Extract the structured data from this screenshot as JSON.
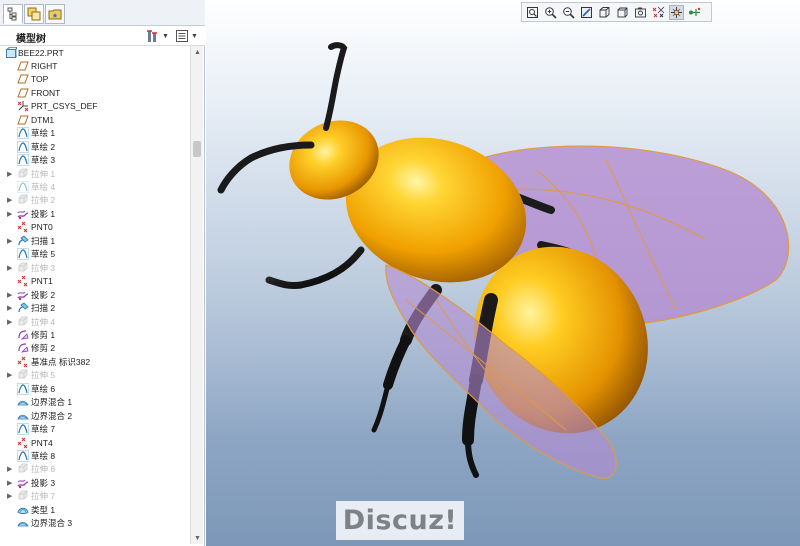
{
  "tabs": [
    {
      "icon": "model-tree-tab-icon",
      "active": true
    },
    {
      "icon": "layers-tab-icon",
      "active": false
    },
    {
      "icon": "favorites-folder-tab-icon",
      "active": false
    }
  ],
  "model_tree": {
    "title": "模型树",
    "items": [
      {
        "label": "BEE22.PRT",
        "icon": "part-icon",
        "expandable": false,
        "dim": false,
        "root": true
      },
      {
        "label": "RIGHT",
        "icon": "datum-plane-icon",
        "expandable": false,
        "dim": false
      },
      {
        "label": "TOP",
        "icon": "datum-plane-icon",
        "expandable": false,
        "dim": false
      },
      {
        "label": "FRONT",
        "icon": "datum-plane-icon",
        "expandable": false,
        "dim": false
      },
      {
        "label": "PRT_CSYS_DEF",
        "icon": "coordinate-system-icon",
        "expandable": false,
        "dim": false
      },
      {
        "label": "DTM1",
        "icon": "datum-plane-icon",
        "expandable": false,
        "dim": false
      },
      {
        "label": "草绘 1",
        "icon": "sketch-icon",
        "expandable": false,
        "dim": false
      },
      {
        "label": "草绘 2",
        "icon": "sketch-icon",
        "expandable": false,
        "dim": false
      },
      {
        "label": "草绘 3",
        "icon": "sketch-icon",
        "expandable": false,
        "dim": false
      },
      {
        "label": "拉伸 1",
        "icon": "extrude-icon",
        "expandable": true,
        "dim": true
      },
      {
        "label": "草绘 4",
        "icon": "sketch-icon",
        "expandable": false,
        "dim": true
      },
      {
        "label": "拉伸 2",
        "icon": "extrude-icon",
        "expandable": true,
        "dim": true
      },
      {
        "label": "投影 1",
        "icon": "project-curve-icon",
        "expandable": true,
        "dim": false
      },
      {
        "label": "PNT0",
        "icon": "datum-point-icon",
        "expandable": false,
        "dim": false
      },
      {
        "label": "扫描 1",
        "icon": "sweep-icon",
        "expandable": true,
        "dim": false
      },
      {
        "label": "草绘 5",
        "icon": "sketch-icon",
        "expandable": false,
        "dim": false
      },
      {
        "label": "拉伸 3",
        "icon": "extrude-icon",
        "expandable": true,
        "dim": true
      },
      {
        "label": "PNT1",
        "icon": "datum-point-icon",
        "expandable": false,
        "dim": false
      },
      {
        "label": "投影 2",
        "icon": "project-curve-icon",
        "expandable": true,
        "dim": false
      },
      {
        "label": "扫描 2",
        "icon": "sweep-icon",
        "expandable": true,
        "dim": false
      },
      {
        "label": "拉伸 4",
        "icon": "extrude-icon",
        "expandable": true,
        "dim": true
      },
      {
        "label": "修剪 1",
        "icon": "trim-icon",
        "expandable": false,
        "dim": false
      },
      {
        "label": "修剪 2",
        "icon": "trim-icon",
        "expandable": false,
        "dim": false
      },
      {
        "label": "基准点 标识382",
        "icon": "datum-point-icon",
        "expandable": false,
        "dim": false
      },
      {
        "label": "拉伸 5",
        "icon": "extrude-icon",
        "expandable": true,
        "dim": true
      },
      {
        "label": "草绘 6",
        "icon": "sketch-icon",
        "expandable": false,
        "dim": false
      },
      {
        "label": "边界混合 1",
        "icon": "boundary-blend-icon",
        "expandable": false,
        "dim": false
      },
      {
        "label": "边界混合 2",
        "icon": "boundary-blend-icon",
        "expandable": false,
        "dim": false
      },
      {
        "label": "草绘 7",
        "icon": "sketch-icon",
        "expandable": false,
        "dim": false
      },
      {
        "label": "PNT4",
        "icon": "datum-point-icon",
        "expandable": false,
        "dim": false
      },
      {
        "label": "草绘 8",
        "icon": "sketch-icon",
        "expandable": false,
        "dim": false
      },
      {
        "label": "拉伸 6",
        "icon": "extrude-icon",
        "expandable": true,
        "dim": true
      },
      {
        "label": "投影 3",
        "icon": "project-curve-icon",
        "expandable": true,
        "dim": false
      },
      {
        "label": "拉伸 7",
        "icon": "extrude-icon",
        "expandable": true,
        "dim": true
      },
      {
        "label": "类型 1",
        "icon": "style-surface-icon",
        "expandable": false,
        "dim": false
      },
      {
        "label": "边界混合 3",
        "icon": "boundary-blend-icon",
        "expandable": false,
        "dim": false
      }
    ]
  },
  "view_toolbar": [
    {
      "icon": "refit-icon",
      "on": false
    },
    {
      "icon": "zoom-in-icon",
      "on": false
    },
    {
      "icon": "zoom-out-icon",
      "on": false
    },
    {
      "icon": "repaint-icon",
      "on": false
    },
    {
      "icon": "display-style-icon",
      "on": false
    },
    {
      "icon": "saved-orientations-icon",
      "on": false
    },
    {
      "icon": "view-manager-icon",
      "on": false
    },
    {
      "icon": "datum-display-filters-icon",
      "on": false
    },
    {
      "icon": "spin-center-icon",
      "on": true
    },
    {
      "icon": "annotation-display-icon",
      "on": false
    }
  ],
  "watermark": "Discuz!",
  "colors": {
    "bee_body": "#f2a500",
    "bee_dark": "#1a1a1a",
    "wing": "#b38ad0",
    "wing_edge": "#e09a40"
  }
}
